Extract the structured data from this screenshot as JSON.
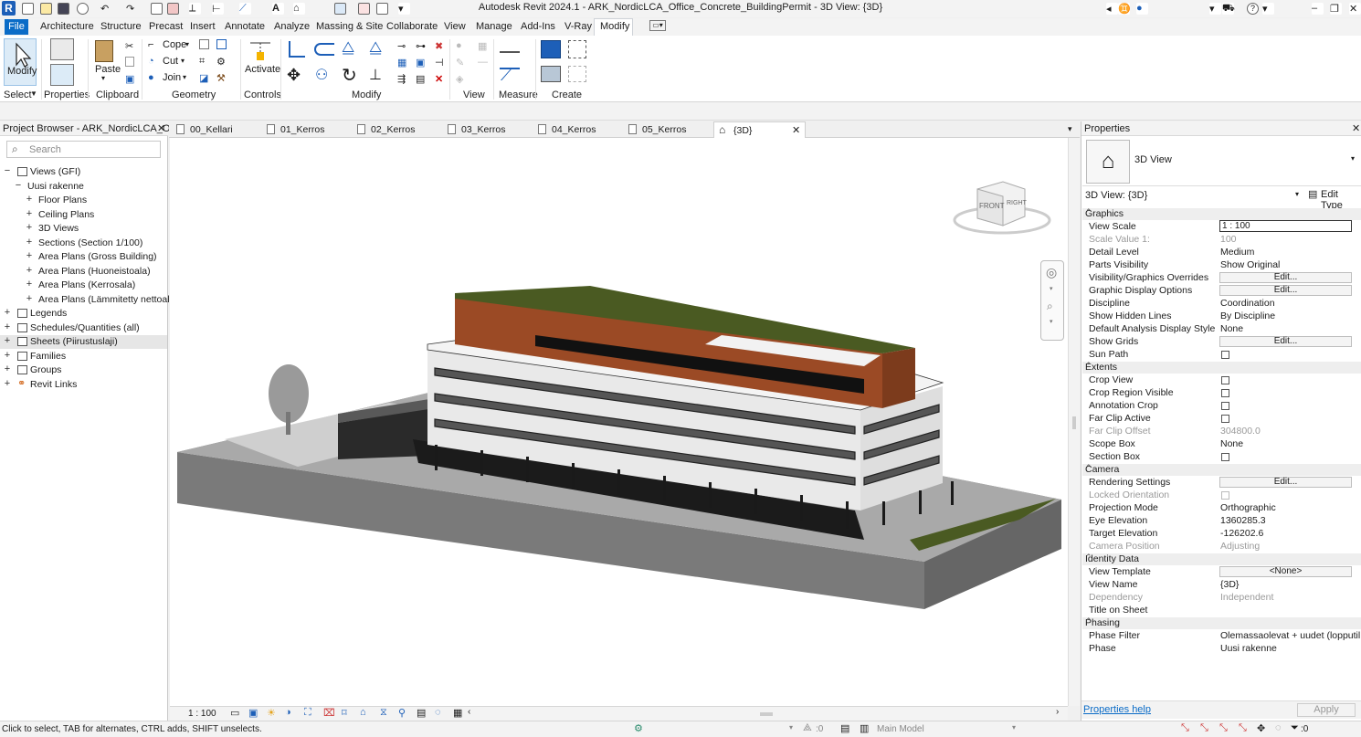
{
  "app": {
    "title": "Autodesk Revit 2024.1 - ARK_NordicLCA_Office_Concrete_BuildingPermit - 3D View: {3D}",
    "logo": "R"
  },
  "menu": {
    "tabs": [
      "File",
      "Architecture",
      "Structure",
      "Precast",
      "Insert",
      "Annotate",
      "Analyze",
      "Massing & Site",
      "Collaborate",
      "View",
      "Manage",
      "Add-Ins",
      "V-Ray",
      "Modify"
    ],
    "active": "Modify"
  },
  "ribbon": {
    "modify_label": "Modify",
    "paste_label": "Paste",
    "cope_label": "Cope",
    "cut_label": "Cut",
    "join_label": "Join",
    "activate_label": "Activate",
    "panels": {
      "select": "Select",
      "properties": "Properties",
      "clipboard": "Clipboard",
      "geometry": "Geometry",
      "controls": "Controls",
      "modify": "Modify",
      "view": "View",
      "measure": "Measure",
      "create": "Create"
    }
  },
  "project_browser": {
    "title": "Project Browser - ARK_NordicLCA_Offic...",
    "search_placeholder": "Search",
    "items": [
      {
        "label": "Views (GFI)",
        "toggle": "−",
        "level": 0,
        "icon": "views-icon"
      },
      {
        "label": "Uusi rakenne",
        "toggle": "−",
        "level": 1,
        "icon": ""
      },
      {
        "label": "Floor Plans",
        "toggle": "+",
        "level": 2,
        "icon": ""
      },
      {
        "label": "Ceiling Plans",
        "toggle": "+",
        "level": 2,
        "icon": ""
      },
      {
        "label": "3D Views",
        "toggle": "+",
        "level": 2,
        "icon": ""
      },
      {
        "label": "Sections (Section 1/100)",
        "toggle": "+",
        "level": 2,
        "icon": ""
      },
      {
        "label": "Area Plans (Gross Building)",
        "toggle": "+",
        "level": 2,
        "icon": ""
      },
      {
        "label": "Area Plans (Huoneistoala)",
        "toggle": "+",
        "level": 2,
        "icon": ""
      },
      {
        "label": "Area Plans (Kerrosala)",
        "toggle": "+",
        "level": 2,
        "icon": ""
      },
      {
        "label": "Area Plans (Lämmitetty nettoala)",
        "toggle": "+",
        "level": 2,
        "icon": ""
      },
      {
        "label": "Legends",
        "toggle": "+",
        "level": 0,
        "icon": "legends-icon"
      },
      {
        "label": "Schedules/Quantities (all)",
        "toggle": "+",
        "level": 0,
        "icon": "schedules-icon"
      },
      {
        "label": "Sheets (Piirustuslaji)",
        "toggle": "+",
        "level": 0,
        "icon": "sheets-icon"
      },
      {
        "label": "Families",
        "toggle": "+",
        "level": 0,
        "icon": "families-icon"
      },
      {
        "label": "Groups",
        "toggle": "+",
        "level": 0,
        "icon": "groups-icon"
      },
      {
        "label": "Revit Links",
        "toggle": "+",
        "level": 0,
        "icon": "links-icon"
      }
    ]
  },
  "view_tabs": [
    {
      "label": "00_Kellari",
      "active": false
    },
    {
      "label": "01_Kerros",
      "active": false
    },
    {
      "label": "02_Kerros",
      "active": false
    },
    {
      "label": "03_Kerros",
      "active": false
    },
    {
      "label": "04_Kerros",
      "active": false
    },
    {
      "label": "05_Kerros",
      "active": false
    },
    {
      "label": "{3D}",
      "active": true
    }
  ],
  "viewcube": {
    "front": "FRONT",
    "right": "RIGHT"
  },
  "view_control": {
    "scale": "1 : 100"
  },
  "properties": {
    "title": "Properties",
    "type_name": "3D View",
    "selector": "3D View: {3D}",
    "edit_type": "Edit Type",
    "help": "Properties help",
    "apply": "Apply",
    "groups": {
      "graphics": "Graphics",
      "extents": "Extents",
      "camera": "Camera",
      "identity": "Identity Data",
      "phasing": "Phasing"
    },
    "rows": {
      "view_scale": {
        "name": "View Scale",
        "value": "1 : 100"
      },
      "scale_value": {
        "name": "Scale Value    1:",
        "value": "100"
      },
      "detail_level": {
        "name": "Detail Level",
        "value": "Medium"
      },
      "parts_visibility": {
        "name": "Parts Visibility",
        "value": "Show Original"
      },
      "vg_overrides": {
        "name": "Visibility/Graphics Overrides",
        "value": "Edit..."
      },
      "graphic_display": {
        "name": "Graphic Display Options",
        "value": "Edit..."
      },
      "discipline": {
        "name": "Discipline",
        "value": "Coordination"
      },
      "hidden_lines": {
        "name": "Show Hidden Lines",
        "value": "By Discipline"
      },
      "analysis_style": {
        "name": "Default Analysis Display Style",
        "value": "None"
      },
      "show_grids": {
        "name": "Show Grids",
        "value": "Edit..."
      },
      "sun_path": {
        "name": "Sun Path",
        "value": ""
      },
      "crop_view": {
        "name": "Crop View",
        "value": ""
      },
      "crop_region": {
        "name": "Crop Region Visible",
        "value": ""
      },
      "annotation_crop": {
        "name": "Annotation Crop",
        "value": ""
      },
      "far_clip_active": {
        "name": "Far Clip Active",
        "value": ""
      },
      "far_clip_offset": {
        "name": "Far Clip Offset",
        "value": "304800.0"
      },
      "scope_box": {
        "name": "Scope Box",
        "value": "None"
      },
      "section_box": {
        "name": "Section Box",
        "value": ""
      },
      "rendering": {
        "name": "Rendering Settings",
        "value": "Edit..."
      },
      "locked_orientation": {
        "name": "Locked Orientation",
        "value": ""
      },
      "projection": {
        "name": "Projection Mode",
        "value": "Orthographic"
      },
      "eye_elevation": {
        "name": "Eye Elevation",
        "value": "1360285.3"
      },
      "target_elevation": {
        "name": "Target Elevation",
        "value": "-126202.6"
      },
      "camera_position": {
        "name": "Camera Position",
        "value": "Adjusting"
      },
      "view_template": {
        "name": "View Template",
        "value": "<None>"
      },
      "view_name": {
        "name": "View Name",
        "value": "{3D}"
      },
      "dependency": {
        "name": "Dependency",
        "value": "Independent"
      },
      "title_on_sheet": {
        "name": "Title on Sheet",
        "value": ""
      },
      "phase_filter": {
        "name": "Phase Filter",
        "value": "Olemassaolevat + uudet (lopputil..."
      },
      "phase": {
        "name": "Phase",
        "value": "Uusi rakenne"
      }
    }
  },
  "status": {
    "hint": "Click to select, TAB for alternates, CTRL adds, SHIFT unselects.",
    "worksets": ":0",
    "model": "Main Model",
    "filter_count": ":0"
  },
  "colors": {
    "accent": "#0b6cc7",
    "facade_brown": "#9b4a25",
    "roof_green": "#4a5a22",
    "ground_grey": "#8e8e8e"
  }
}
